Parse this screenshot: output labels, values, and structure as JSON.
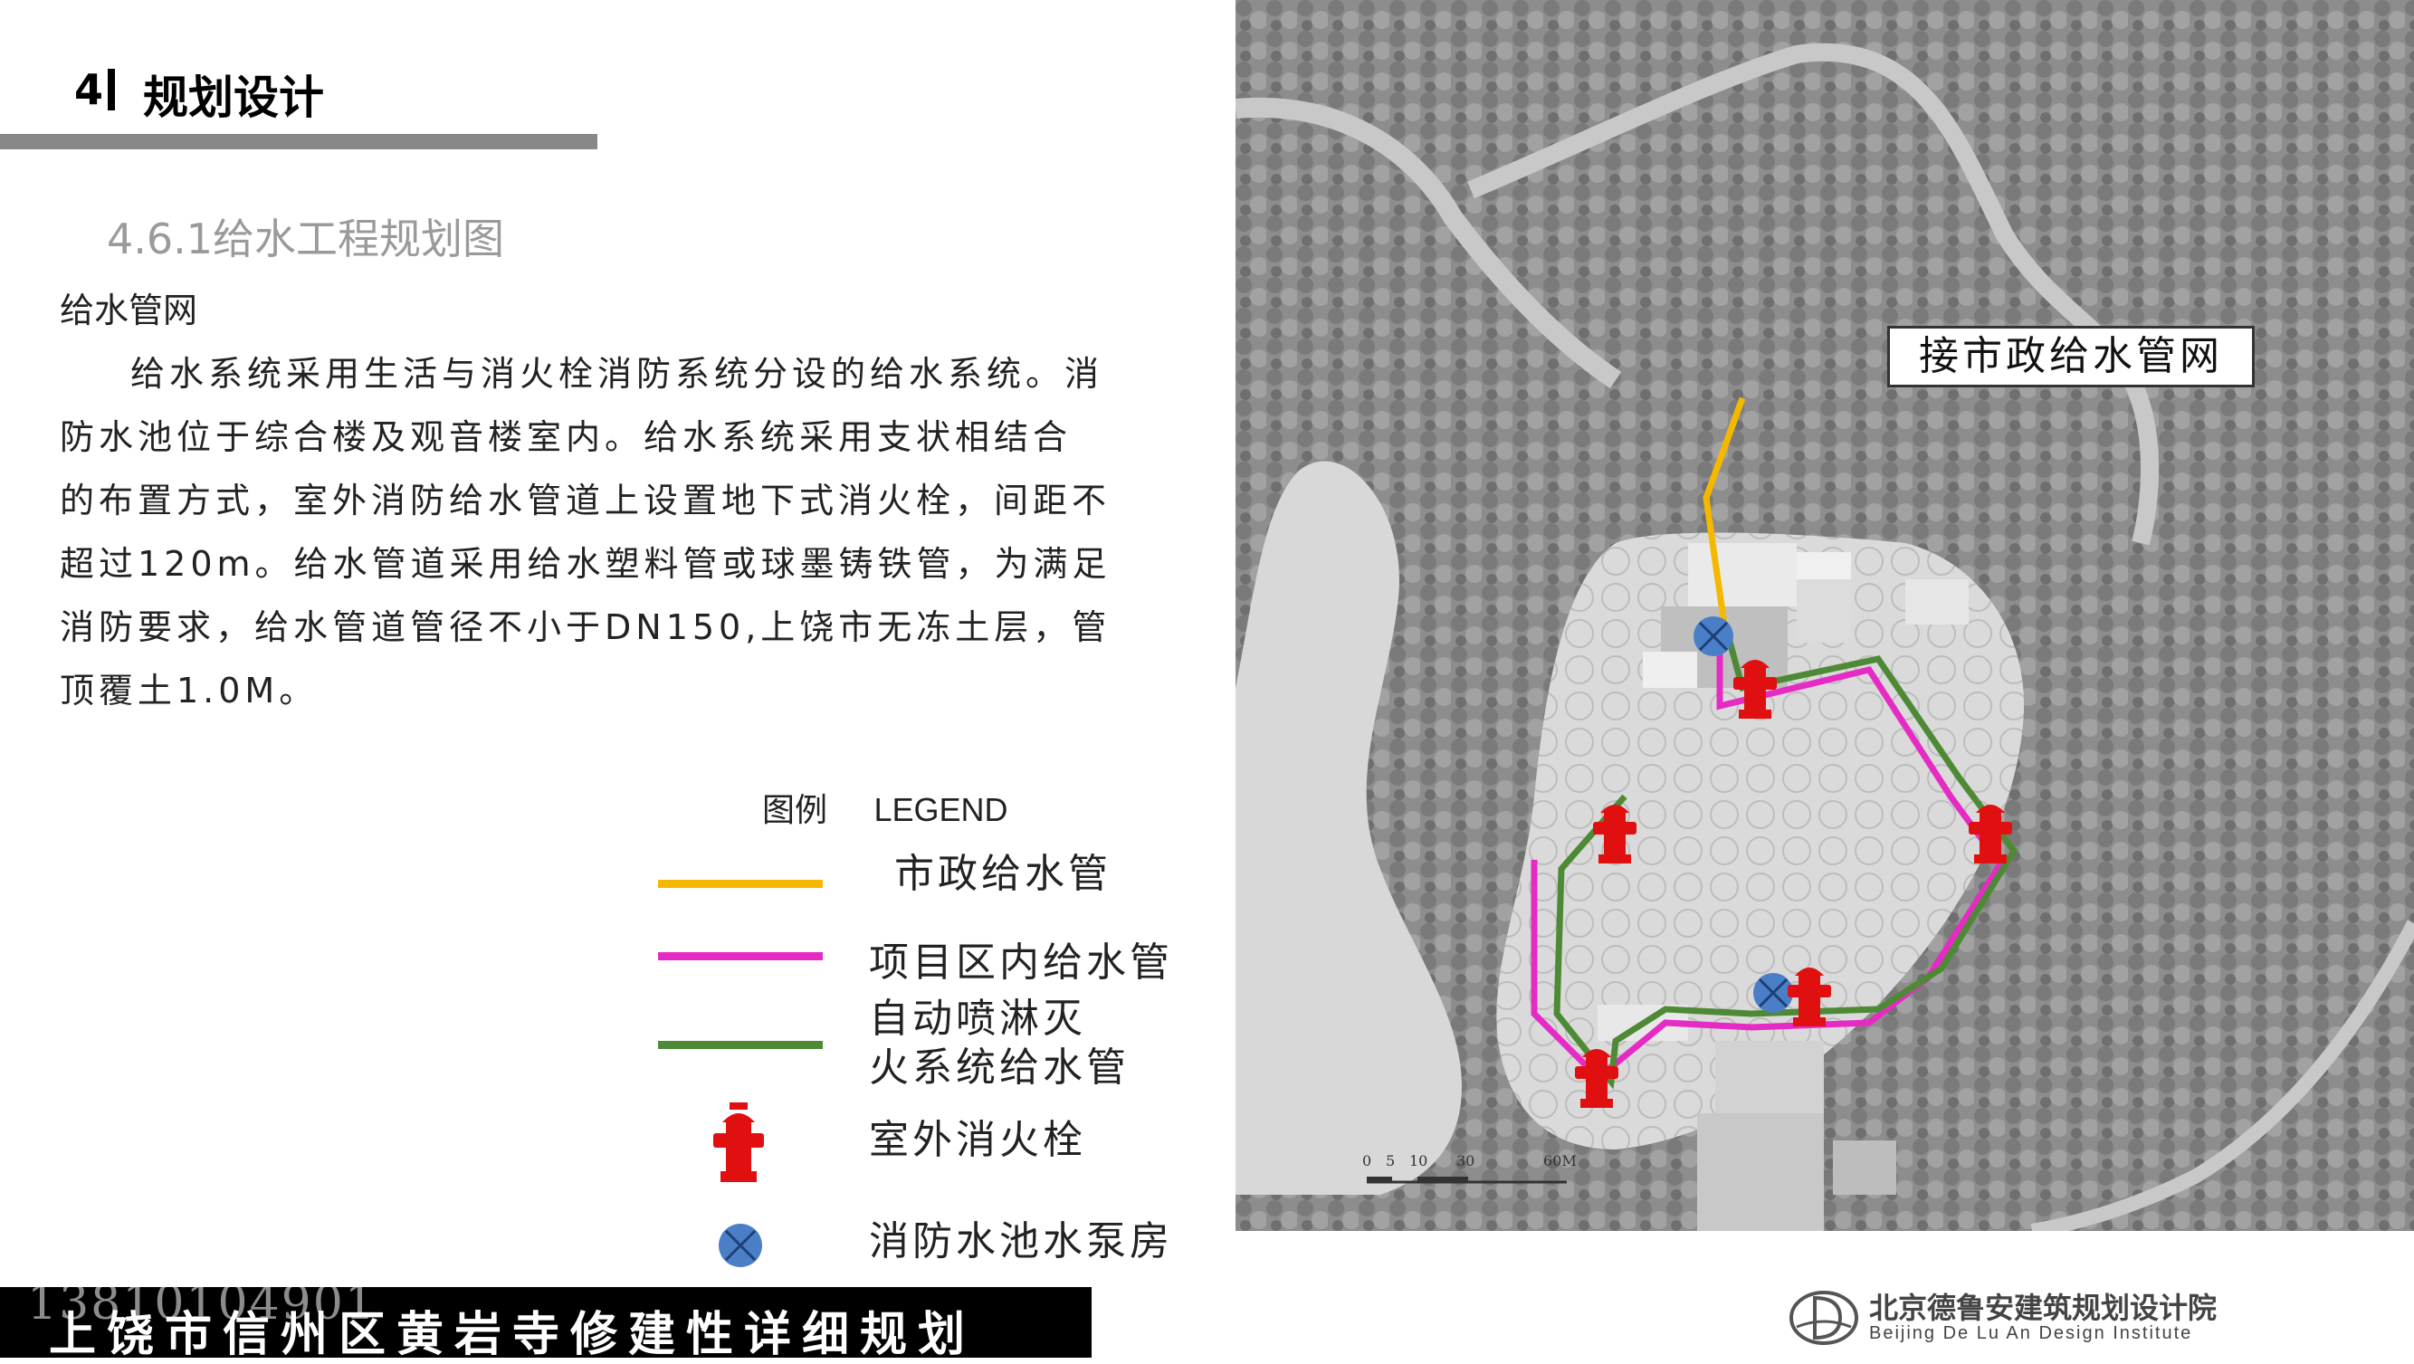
{
  "header": {
    "number": "4",
    "title": "规划设计"
  },
  "section_title": "4.6.1给水工程规划图",
  "subheading": "给水管网",
  "body_lines": [
    "给水系统采用生活与消火栓消防系统分设的给水系统。消",
    "防水池位于综合楼及观音楼室内。给水系统采用支状相结合",
    "的布置方式，室外消防给水管道上设置地下式消火栓，间距不",
    "超过120m。给水管道采用给水塑料管或球墨铸铁管，为满足",
    "消防要求，给水管道管径不小于DN150,上饶市无冻土层，管",
    "顶覆土1.0M。"
  ],
  "legend": {
    "title_cn": "图例",
    "title_en": "LEGEND",
    "items": [
      {
        "label": "市政给水管",
        "color": "#F5B800"
      },
      {
        "label": "项目区内给水管",
        "color": "#E52BC4"
      },
      {
        "label_line1": "自动喷淋灭",
        "label_line2": "火系统给水管",
        "color": "#4E8A35"
      },
      {
        "label": "室外消火栓",
        "icon": "fire-hydrant-icon",
        "color": "#E01010"
      },
      {
        "label": "消防水池水泵房",
        "icon": "pump-room-icon",
        "color": "#4A7FC8"
      }
    ]
  },
  "map": {
    "callout": "接市政给水管网",
    "scale_labels": [
      "0",
      "5",
      "10",
      "30",
      "60M"
    ]
  },
  "footer": {
    "title": "上饶市信州区黄岩寺修建性详细规划",
    "phone": "13810104901"
  },
  "institute": {
    "name_cn": "北京德鲁安建筑规划设计院",
    "name_en": "Beijing De Lu An Design Institute",
    "logo_icon": "institute-logo-icon"
  }
}
